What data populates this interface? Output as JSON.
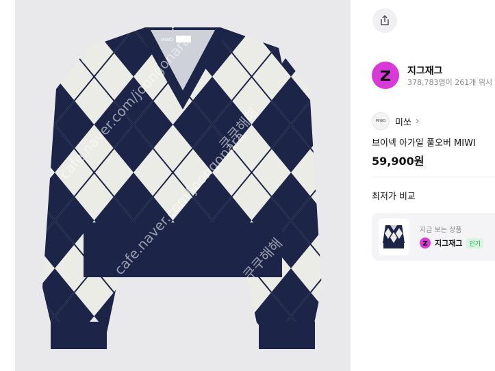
{
  "product": {
    "photo_alt": "argyle-sweater-photo",
    "neck_label_brand": "MIWO",
    "watermarks": [
      "cafe.naver.com/joongonara",
      "쿠쿠해해",
      "cafe.naver.com/joongonara",
      "쿠쿠해해"
    ],
    "title": "브이넥 아가일 풀오버 MIWI",
    "price": "59,900원"
  },
  "seller": {
    "logo_letter": "Z",
    "name": "지그재그",
    "stats": "378,783명이 261개 위시"
  },
  "brand": {
    "logo_text": "MIWO",
    "name": "미쏘",
    "chevron": "›"
  },
  "compare": {
    "title": "최저가 비교",
    "card": {
      "label": "지금 보는 상품",
      "logo_letter": "Z",
      "seller_name": "지그재그",
      "badge": "인기"
    }
  },
  "colors": {
    "navy": "#1c2447",
    "cream": "#ecece6",
    "zigzag": "#d83ad8",
    "popular_green": "#1f9d55"
  },
  "icons": {
    "share": "share-icon"
  }
}
